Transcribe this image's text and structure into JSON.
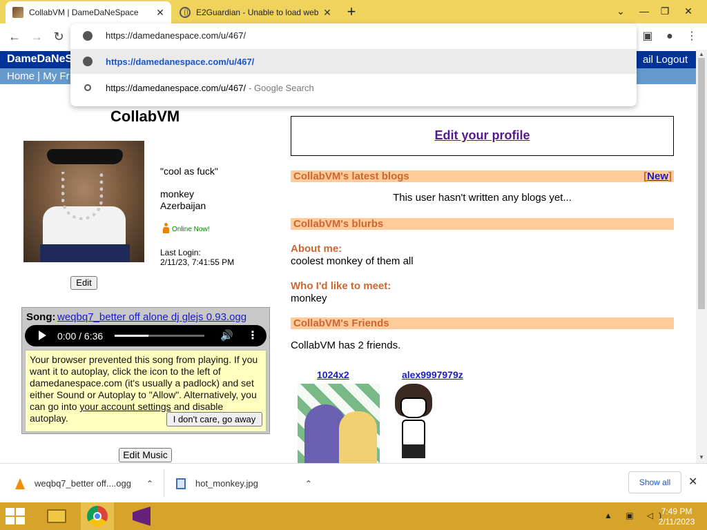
{
  "browser": {
    "tabs": [
      {
        "title": "CollabVM | DameDaNeSpace",
        "active": true
      },
      {
        "title": "E2Guardian - Unable to load web",
        "active": false
      }
    ],
    "new_tab": "+",
    "window_controls": {
      "dropdown": "⌄",
      "minimize": "—",
      "restore": "❐",
      "close": "✕"
    },
    "nav": {
      "back": "←",
      "forward": "→",
      "reload": "↻"
    },
    "omnibox": {
      "value": "https://damedanespace.com/u/467/",
      "suggestions": [
        {
          "text": "https://damedanespace.com/u/467/",
          "type": "url"
        },
        {
          "text": "https://damedanespace.com/u/467/",
          "suffix": "- Google Search",
          "type": "search"
        }
      ]
    }
  },
  "site": {
    "logo": "DameDaNeSp",
    "header_links": "ail  Logout",
    "nav_links": "Home | My Fr"
  },
  "profile": {
    "name": "CollabVM",
    "quote": "\"cool as fuck\"",
    "gender": "monkey",
    "country": "Azerbaijan",
    "online": "Online Now!",
    "last_login_label": "Last Login:",
    "last_login": "2/11/23, 7:41:55 PM",
    "edit_label": "Edit"
  },
  "song": {
    "label": "Song:",
    "link": "weqbq7_better off alone dj glejs 0.93.ogg",
    "time": "0:00 / 6:36",
    "progress": 0.38,
    "warning_pre": "Your browser prevented this song from playing. If you want it to autoplay, click the icon to the left of damedanespace.com (it's usually a padlock) and set either Sound or Autoplay to \"Allow\". Alternatively, you can go into ",
    "warning_link": "your account settings",
    "warning_post": " and disable autoplay.",
    "dont_care": "I don't care, go away",
    "edit_music": "Edit Music"
  },
  "main": {
    "edit_profile": "Edit your profile",
    "blogs_header": "CollabVM's latest blogs",
    "new_link_open": "[",
    "new_link": "New",
    "new_link_close": "]",
    "no_blogs": "This user hasn't written any blogs yet...",
    "blurbs_header": "CollabVM's blurbs",
    "about_label": "About me:",
    "about_text": "coolest monkey of them all",
    "meet_label": "Who I'd like to meet:",
    "meet_text": "monkey",
    "friends_header": "CollabVM's Friends",
    "friends_count": "CollabVM has 2 friends.",
    "friends": [
      {
        "name": "1024x2"
      },
      {
        "name": "alex9997979z"
      }
    ]
  },
  "downloads": {
    "items": [
      {
        "name": "weqbq7_better off....ogg",
        "icon": "vlc-cone-icon"
      },
      {
        "name": "hot_monkey.jpg",
        "icon": "image-file-icon"
      }
    ],
    "show_all": "Show all",
    "close": "✕"
  },
  "taskbar": {
    "time": "7:49 PM",
    "date": "2/11/2023",
    "tray": "▲ ▣ ◁)"
  }
}
